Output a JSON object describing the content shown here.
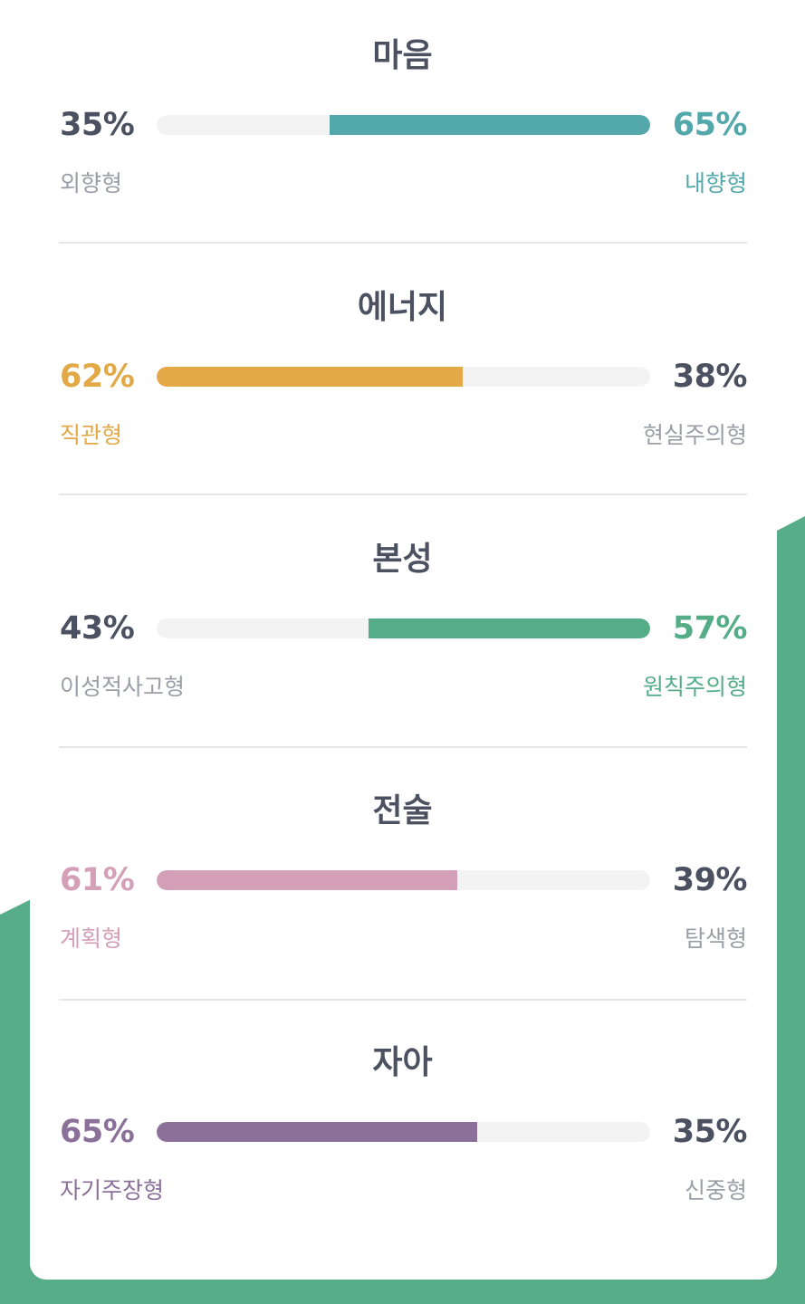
{
  "colors": {
    "background_green": "#58ad89",
    "text_dark": "#4b5160",
    "text_muted": "#9a9ea6",
    "track": "#f3f3f3"
  },
  "sections": [
    {
      "title": "마음",
      "left": {
        "percent": "35%",
        "label": "외향형"
      },
      "right": {
        "percent": "65%",
        "label": "내향형"
      },
      "dominant": "right",
      "dominant_fraction": 0.65,
      "color": "#52a8ab"
    },
    {
      "title": "에너지",
      "left": {
        "percent": "62%",
        "label": "직관형"
      },
      "right": {
        "percent": "38%",
        "label": "현실주의형"
      },
      "dominant": "left",
      "dominant_fraction": 0.62,
      "color": "#e3a947"
    },
    {
      "title": "본성",
      "left": {
        "percent": "43%",
        "label": "이성적사고형"
      },
      "right": {
        "percent": "57%",
        "label": "원칙주의형"
      },
      "dominant": "right",
      "dominant_fraction": 0.57,
      "color": "#55ad87"
    },
    {
      "title": "전술",
      "left": {
        "percent": "61%",
        "label": "계획형"
      },
      "right": {
        "percent": "39%",
        "label": "탐색형"
      },
      "dominant": "left",
      "dominant_fraction": 0.61,
      "color": "#d3a0b7"
    },
    {
      "title": "자아",
      "left": {
        "percent": "65%",
        "label": "자기주장형"
      },
      "right": {
        "percent": "35%",
        "label": "신중형"
      },
      "dominant": "left",
      "dominant_fraction": 0.65,
      "color": "#8b7099"
    }
  ]
}
